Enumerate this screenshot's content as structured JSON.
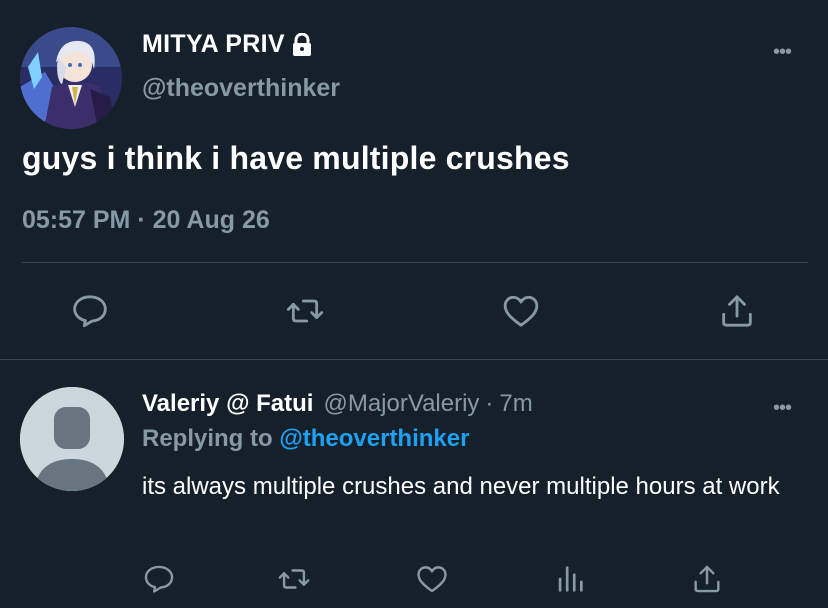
{
  "main_tweet": {
    "display_name": "MITYA PRIV",
    "handle": "@theoverthinker",
    "text": "guys i think i have multiple crushes",
    "timestamp": "05:57 PM · 20 Aug 26",
    "more_label": "•••"
  },
  "reply": {
    "display_name": "Valeriy @ Fatui",
    "handle": "@MajorValeriy",
    "separator": "·",
    "time": "7m",
    "replying_label": "Replying to",
    "replying_to": "@theoverthinker",
    "text": "its always multiple crushes and never multiple hours at work",
    "more_label": "•••"
  },
  "colors": {
    "background": "#15202b",
    "secondary_text": "#8899a6",
    "link": "#1da1f2",
    "divider": "#38444d"
  },
  "icons": {
    "main_actions": [
      "reply-icon",
      "retweet-icon",
      "like-icon",
      "share-icon"
    ],
    "reply_actions": [
      "reply-icon",
      "retweet-icon",
      "like-icon",
      "analytics-icon",
      "share-icon"
    ],
    "protected": "lock-icon"
  }
}
